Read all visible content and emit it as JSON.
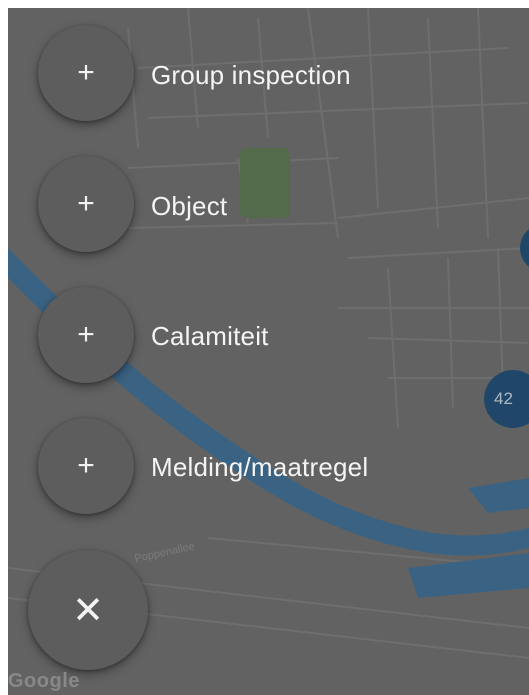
{
  "speed_dial": {
    "items": [
      {
        "icon": "plus-icon",
        "label": "Group inspection"
      },
      {
        "icon": "plus-icon",
        "label": "Object"
      },
      {
        "icon": "plus-icon",
        "label": "Calamiteit"
      },
      {
        "icon": "plus-icon",
        "label": "Melding/maatregel"
      }
    ],
    "close_icon": "close-icon",
    "plus_glyph": "+",
    "close_glyph": "✕"
  },
  "map": {
    "street_label": "Poppenallee",
    "cluster_label": "42",
    "attribution": "Google",
    "colors": {
      "water": "#3f6f96",
      "park": "#5d7a53",
      "overlay": "#6f6f6f",
      "cluster": "#1f4f78"
    }
  }
}
